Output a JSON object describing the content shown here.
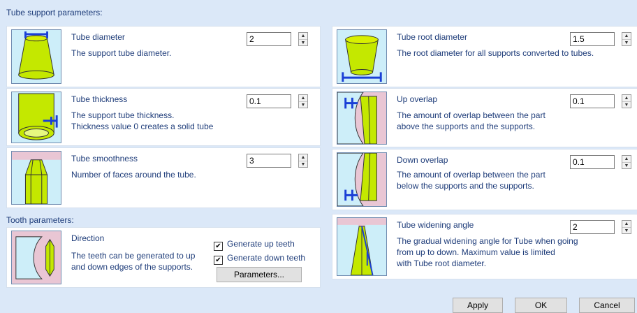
{
  "sections": {
    "tube_support": "Tube support parameters:",
    "tooth": "Tooth parameters:"
  },
  "panels": {
    "tube_diameter": {
      "title": "Tube diameter",
      "desc": [
        "The support tube diameter."
      ],
      "value": "2"
    },
    "tube_thickness": {
      "title": "Tube thickness",
      "desc": [
        "The support tube thickness.",
        "Thickness value 0 creates a solid tube"
      ],
      "value": "0.1"
    },
    "tube_smoothness": {
      "title": "Tube smoothness",
      "desc": [
        "Number of faces around the tube."
      ],
      "value": "3"
    },
    "direction": {
      "title": "Direction",
      "desc": [
        "The teeth can be generated to up",
        "and down edges of the supports."
      ]
    },
    "tube_root_diameter": {
      "title": "Tube root diameter",
      "desc": [
        "The root diameter for all supports converted to tubes."
      ],
      "value": "1.5"
    },
    "up_overlap": {
      "title": "Up overlap",
      "desc": [
        "The amount of overlap between the part",
        "above the supports and the supports."
      ],
      "value": "0.1"
    },
    "down_overlap": {
      "title": "Down overlap",
      "desc": [
        "The amount of overlap between the part",
        "below the supports and the supports."
      ],
      "value": "0.1"
    },
    "tube_widening_angle": {
      "title": "Tube widening angle",
      "desc": [
        "The gradual widening angle for Tube when going",
        "from up to down. Maximum value is limited",
        "with Tube root diameter."
      ],
      "value": "2"
    }
  },
  "checkboxes": {
    "up_teeth": {
      "label": "Generate up teeth",
      "checked": true
    },
    "down_teeth": {
      "label": "Generate down teeth",
      "checked": true
    }
  },
  "buttons": {
    "parameters": "Parameters...",
    "apply": "Apply",
    "ok": "OK",
    "cancel": "Cancel"
  },
  "spinner": {
    "up": "▲",
    "down": "▼"
  },
  "check_glyph": "✔",
  "colors": {
    "background": "#dbe8f8",
    "text": "#1f3d7a",
    "icon_bg": "#cdeef9",
    "tube": "#c4e800",
    "part": "#e9c6d4",
    "marker": "#1a3fd6"
  }
}
